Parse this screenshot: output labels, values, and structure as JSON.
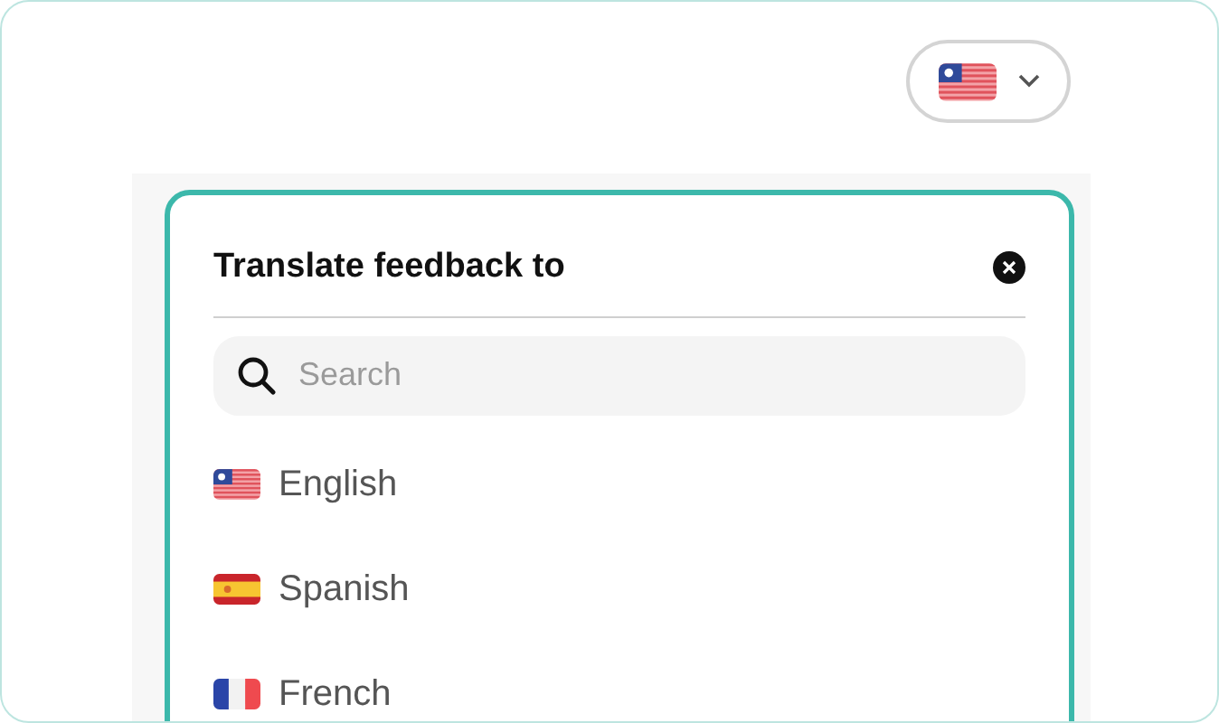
{
  "language_button": {
    "kind": "us"
  },
  "dialog": {
    "title": "Translate feedback to",
    "search": {
      "placeholder": "Search"
    },
    "languages": [
      {
        "label": "English",
        "kind": "us"
      },
      {
        "label": "Spanish",
        "kind": "es"
      },
      {
        "label": "French",
        "kind": "fr"
      }
    ]
  }
}
